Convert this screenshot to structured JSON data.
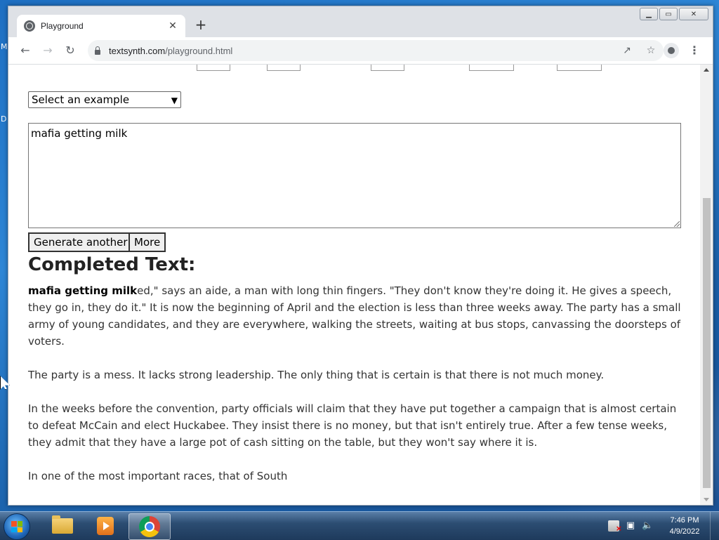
{
  "desktop": {
    "edge_letters": [
      "M",
      "D"
    ]
  },
  "browser": {
    "tab_title": "Playground",
    "tab_close": "✕",
    "new_tab": "+",
    "url_host": "textsynth.com",
    "url_path": "/playground.html",
    "window_controls": {
      "minimize": "▁",
      "maximize": "▭",
      "close": "✕"
    }
  },
  "page": {
    "example_select": "Select an example",
    "prompt_text": "mafia getting milk",
    "buttons": {
      "generate": "Generate another",
      "more": "More"
    },
    "heading": "Completed Text:",
    "completed": {
      "prompt_bold": "mafia getting milk",
      "first_continuation": "ed,\" says an aide, a man with long thin fingers. \"They don't know they're doing it. He gives a speech, they go in, they do it.\" It is now the beginning of April and the election is less than three weeks away. The party has a small army of young candidates, and they are everywhere, walking the streets, waiting at bus stops, canvassing the doorsteps of voters.",
      "paragraphs": [
        "The party is a mess. It lacks strong leadership. The only thing that is certain is that there is not much money.",
        "In the weeks before the convention, party officials will claim that they have put together a campaign that is almost certain to defeat McCain and elect Huckabee. They insist there is no money, but that isn't entirely true. After a few tense weeks, they admit that they have a large pot of cash sitting on the table, but they won't say where it is.",
        "In one of the most important races, that of South"
      ]
    }
  },
  "taskbar": {
    "time": "7:46 PM",
    "date": "4/9/2022"
  }
}
